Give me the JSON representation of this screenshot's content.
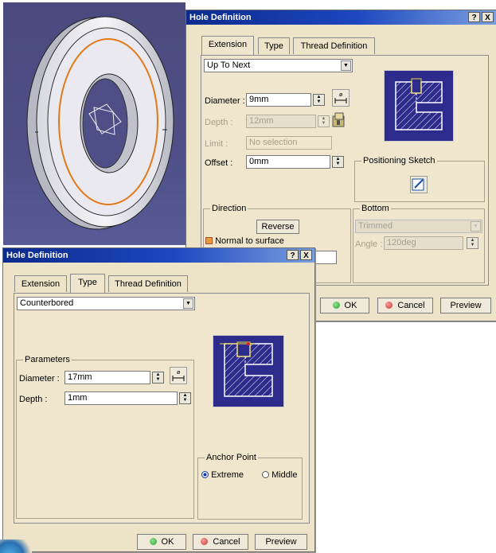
{
  "back_dialog": {
    "title": "Hole Definition",
    "help_btn": "?",
    "close_btn": "X",
    "tabs": [
      "Extension",
      "Type",
      "Thread Definition"
    ],
    "active_tab": "Extension",
    "extension_type": "Up To Next",
    "diameter_label": "Diameter :",
    "diameter_value": "9mm",
    "depth_label": "Depth :",
    "depth_value": "12mm",
    "limit_label": "Limit :",
    "limit_value": "No selection",
    "offset_label": "Offset :",
    "offset_value": "0mm",
    "positioning_sketch_label": "Positioning Sketch",
    "direction_label": "Direction",
    "reverse_btn": "Reverse",
    "normal_to_surface_label": "Normal to surface",
    "bottom_label": "Bottom",
    "bottom_value": "Trimmed",
    "angle_label": "Angle :",
    "angle_value": "120deg",
    "ok_btn": "OK",
    "cancel_btn": "Cancel",
    "preview_btn": "Preview"
  },
  "front_dialog": {
    "title": "Hole Definition",
    "help_btn": "?",
    "close_btn": "X",
    "tabs": [
      "Extension",
      "Type",
      "Thread Definition"
    ],
    "active_tab": "Type",
    "hole_type": "Counterbored",
    "parameters_label": "Parameters",
    "diameter_label": "Diameter :",
    "diameter_value": "17mm",
    "depth_label": "Depth :",
    "depth_value": "1mm",
    "anchor_point_label": "Anchor Point",
    "anchor_extreme": "Extreme",
    "anchor_middle": "Middle",
    "anchor_selected": "Extreme",
    "ok_btn": "OK",
    "cancel_btn": "Cancel",
    "preview_btn": "Preview"
  },
  "colors": {
    "title_bar": "#1d47c0",
    "dialog_bg": "#ede3c8",
    "viewport_bg": "#4e4f86",
    "preview_bg": "#2d2c8c",
    "part_outline": "#e07a1a",
    "ok_icon": "#2aa52a",
    "cancel_icon": "#d0302a"
  }
}
